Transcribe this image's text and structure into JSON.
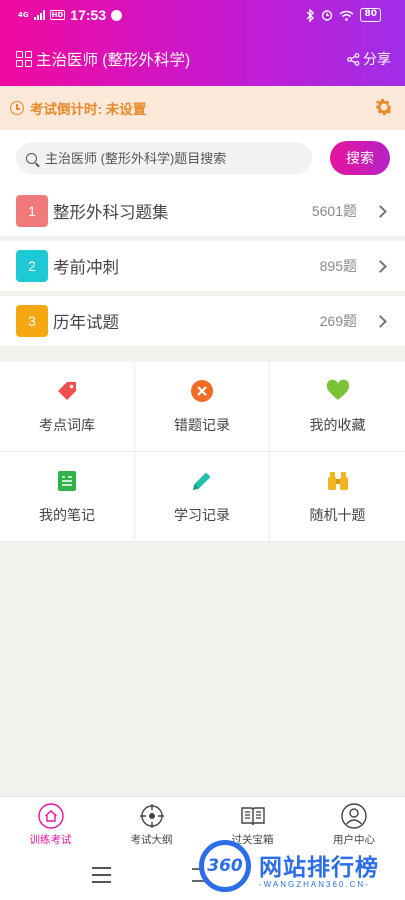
{
  "status_bar": {
    "network": "4G",
    "hd": "HD",
    "time": "17:53",
    "battery": "80"
  },
  "header": {
    "title": "主治医师 (整形外科学)",
    "share_label": "分享"
  },
  "countdown": {
    "text": "考试倒计时: 未设置"
  },
  "search": {
    "placeholder": "主治医师 (整形外科学)题目搜索",
    "button_label": "搜索"
  },
  "list": [
    {
      "num": "1",
      "label": "整形外科习题集",
      "count": "5601题",
      "color": "#f07a7a"
    },
    {
      "num": "2",
      "label": "考前冲刺",
      "count": "895题",
      "color": "#1ec9d6"
    },
    {
      "num": "3",
      "label": "历年试题",
      "count": "269题",
      "color": "#f5a70f"
    }
  ],
  "grid": [
    {
      "label": "考点词库",
      "icon": "tag-icon",
      "color": "#ef4f4f"
    },
    {
      "label": "错题记录",
      "icon": "close-circle-icon",
      "color": "#f36b25"
    },
    {
      "label": "我的收藏",
      "icon": "heart-icon",
      "color": "#7cc236"
    },
    {
      "label": "我的笔记",
      "icon": "note-icon",
      "color": "#32b24a"
    },
    {
      "label": "学习记录",
      "icon": "pencil-icon",
      "color": "#23c0b0"
    },
    {
      "label": "随机十题",
      "icon": "binoculars-icon",
      "color": "#f1b51d"
    }
  ],
  "tabs": [
    {
      "label": "训练考试",
      "icon": "home-icon"
    },
    {
      "label": "考试大纲",
      "icon": "target-icon"
    },
    {
      "label": "过关宝箱",
      "icon": "book-icon"
    },
    {
      "label": "用户中心",
      "icon": "user-icon"
    }
  ],
  "watermark": {
    "badge": "360",
    "text": "网站排行榜",
    "sub": "-WANGZHAN360.CN-"
  },
  "colors": {
    "accent": "#e7139d",
    "countdown": "#e8892a"
  }
}
